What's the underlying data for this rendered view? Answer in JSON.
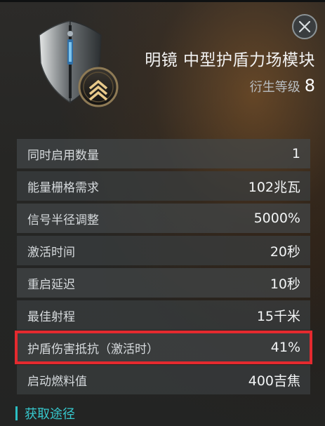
{
  "item": {
    "name": "明镜 中型护盾力场模块",
    "derive_label": "衍生等级",
    "derive_level": "8",
    "tier_icon": "triple-chevron-rank-icon"
  },
  "attributes": [
    {
      "label": "同时启用数量",
      "value": "1"
    },
    {
      "label": "能量栅格需求",
      "value": "102兆瓦"
    },
    {
      "label": "信号半径调整",
      "value": "5000%"
    },
    {
      "label": "激活时间",
      "value": "20秒"
    },
    {
      "label": "重启延迟",
      "value": "10秒"
    },
    {
      "label": "最佳射程",
      "value": "15千米"
    },
    {
      "label": "护盾伤害抵抗（激活时）",
      "value": "41%"
    },
    {
      "label": "启动燃料值",
      "value": "400吉焦"
    }
  ],
  "acquisition_label": "获取途径",
  "colors": {
    "accent": "#36c7cc",
    "highlight": "#e52a2f"
  }
}
